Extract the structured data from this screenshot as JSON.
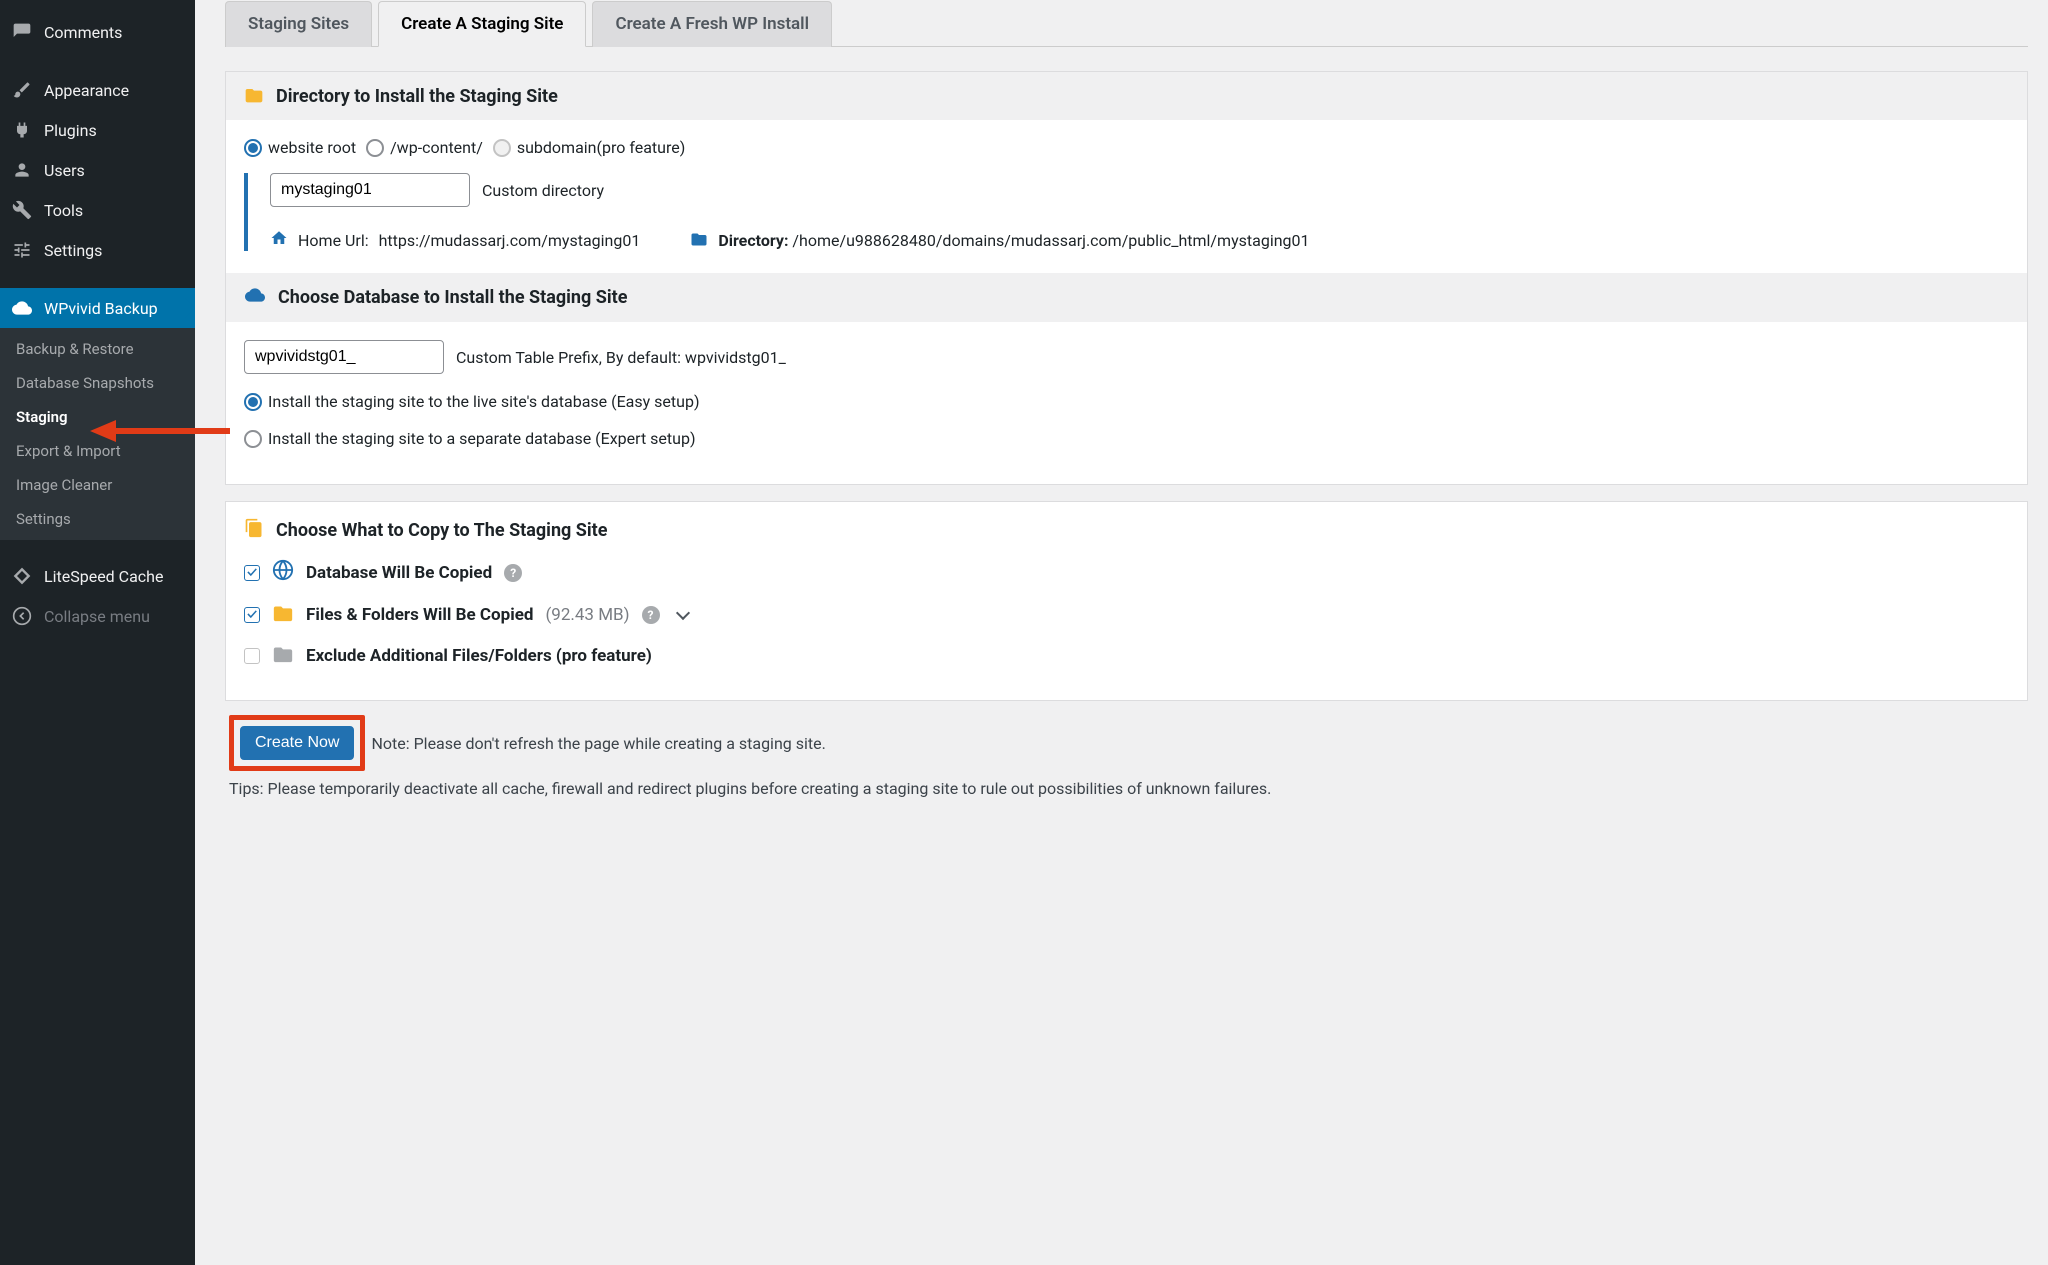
{
  "sidebar": {
    "items": [
      {
        "label": "Comments"
      },
      {
        "label": "Appearance"
      },
      {
        "label": "Plugins"
      },
      {
        "label": "Users"
      },
      {
        "label": "Tools"
      },
      {
        "label": "Settings"
      },
      {
        "label": "WPvivid Backup"
      },
      {
        "label": "LiteSpeed Cache"
      },
      {
        "label": "Collapse menu"
      }
    ],
    "submenu": [
      {
        "label": "Backup & Restore"
      },
      {
        "label": "Database Snapshots"
      },
      {
        "label": "Staging"
      },
      {
        "label": "Export & Import"
      },
      {
        "label": "Image Cleaner"
      },
      {
        "label": "Settings"
      }
    ]
  },
  "tabs": {
    "staging_sites": "Staging Sites",
    "create_staging": "Create A Staging Site",
    "fresh_install": "Create A Fresh WP Install"
  },
  "directory": {
    "header": "Directory to Install the Staging Site",
    "opt_root": "website root",
    "opt_wpcontent": "/wp-content/",
    "opt_subdomain": "subdomain(pro feature)",
    "custom_dir_value": "mystaging01",
    "custom_dir_label": "Custom directory",
    "home_url_label": "Home Url:",
    "home_url_value": "https://mudassarj.com/mystaging01",
    "dir_label": "Directory:",
    "dir_value": "/home/u988628480/domains/mudassarj.com/public_html/mystaging01"
  },
  "database": {
    "header": "Choose Database to Install the Staging Site",
    "prefix_value": "wpvividstg01_",
    "prefix_label": "Custom Table Prefix, By default: wpvividstg01_",
    "opt_easy": "Install the staging site to the live site's database (Easy setup)",
    "opt_expert": "Install the staging site to a separate database (Expert setup)"
  },
  "copy": {
    "header": "Choose What to Copy to The Staging Site",
    "db_label": "Database Will Be Copied",
    "files_label": "Files & Folders Will Be Copied",
    "files_size": "(92.43 MB)",
    "exclude_label": "Exclude Additional Files/Folders (pro feature)"
  },
  "footer": {
    "button": "Create Now",
    "note": "Note: Please don't refresh the page while creating a staging site.",
    "tips": "Tips: Please temporarily deactivate all cache, firewall and redirect plugins before creating a staging site to rule out possibilities of unknown failures."
  }
}
